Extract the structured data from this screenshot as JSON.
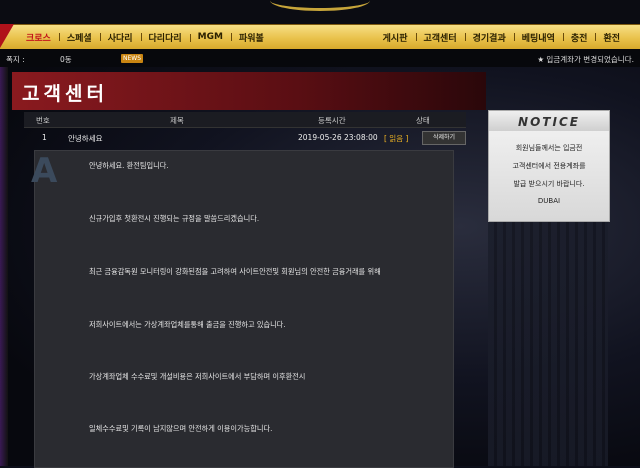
{
  "nav": {
    "left": [
      "크로스",
      "스페셜",
      "사다리",
      "다리다리",
      "MGM",
      "파워볼"
    ],
    "right": [
      "게시판",
      "고객센터",
      "경기결과",
      "베팅내역",
      "충전",
      "환전"
    ]
  },
  "subbar": {
    "points_label": "폭지 :",
    "points_value": "0동",
    "news_badge": "NEWS",
    "ticker": "★ 입금계좌가 변경되었습니다."
  },
  "page": {
    "title": "고객센터"
  },
  "table": {
    "headers": {
      "no": "번호",
      "subject": "제목",
      "date": "등록시간",
      "status": "상태"
    },
    "row": {
      "no": "1",
      "subject": "안녕하세요",
      "date": "2019-05-26 23:08:00",
      "status": "[ 읽음 ]",
      "delete": "삭제하기"
    }
  },
  "content": {
    "paragraphs": [
      "안녕하세요. 환전팀입니다.",
      "신규가입후 첫환전시 진행되는 규정을 말씀드리겠습니다.",
      "최근 금융감독원 모니터링이 강화된점을 고려하여 사이트안전및 회원님의 안전한 금융거래를 위해",
      "저희사이트에서는 가상계좌업체를통해 출금을 진행하고 있습니다.",
      "가상계좌업체 수수료및 개설비용은 저희사이트에서 부담하며 이후환전시",
      "일체수수료및 기록이 남지않으며 안전하게 이용이가능합니다."
    ]
  },
  "notice": {
    "title": "NOTICE",
    "lines": [
      "회원님들께서는 입금전",
      "고객센터에서 전용계좌를",
      "발급 받으시기 바랍니다.",
      "DUBAI"
    ]
  },
  "colors": {
    "nav_gold": "#e9c24c",
    "accent_red": "#b0121a",
    "title_red": "#8a1a1f"
  }
}
